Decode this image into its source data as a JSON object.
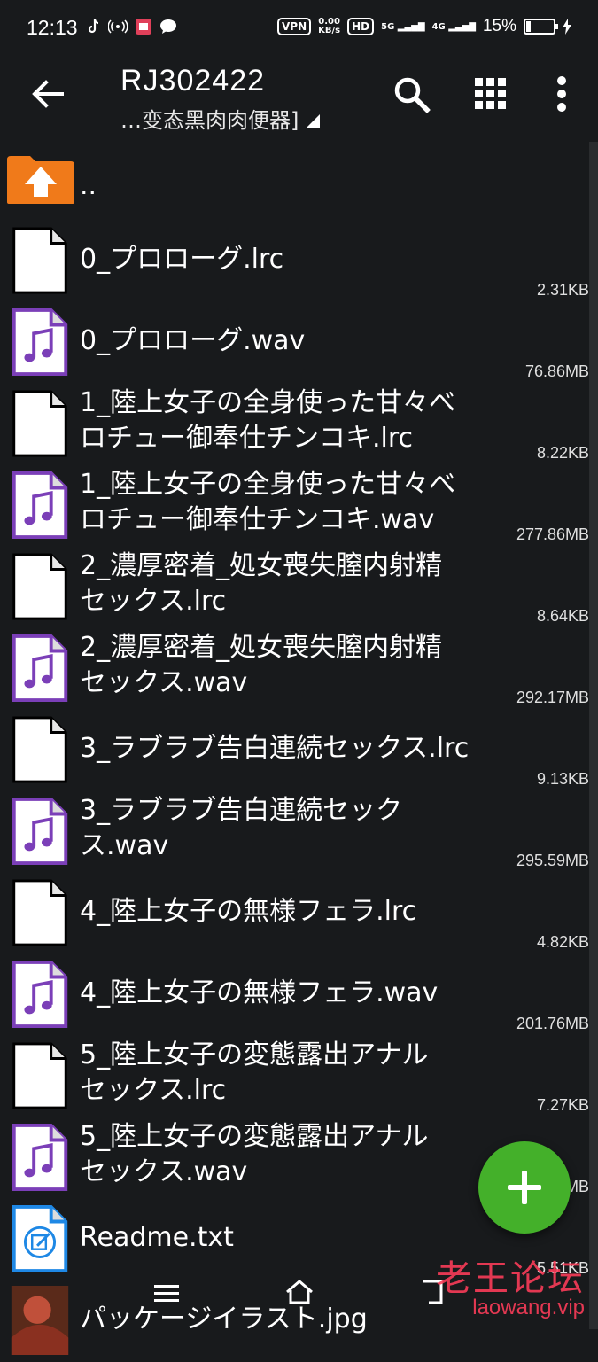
{
  "status_bar": {
    "time": "12:13",
    "vpn": "VPN",
    "net_speed_top": "0.00",
    "net_speed_unit": "KB/s",
    "hd": "HD",
    "sig1": "5G",
    "sig2": "4G",
    "battery": "15%"
  },
  "toolbar": {
    "title": "RJ302422",
    "subtitle": "…变态黑肉肉便器]"
  },
  "parent_dir": "..",
  "files": [
    {
      "name_lines": [
        "0_プロローグ.lrc"
      ],
      "size": "2.31KB",
      "type": "text"
    },
    {
      "name_lines": [
        "0_プロローグ.wav"
      ],
      "size": "76.86MB",
      "type": "audio"
    },
    {
      "name_lines": [
        "1_陸上女子の全身使った甘々べ",
        "ロチュー御奉仕チンコキ.lrc"
      ],
      "size": "8.22KB",
      "type": "text"
    },
    {
      "name_lines": [
        "1_陸上女子の全身使った甘々べ",
        "ロチュー御奉仕チンコキ.wav"
      ],
      "size": "277.86MB",
      "type": "audio"
    },
    {
      "name_lines": [
        "2_濃厚密着_処女喪失膣内射精",
        "セックス.lrc"
      ],
      "size": "8.64KB",
      "type": "text"
    },
    {
      "name_lines": [
        "2_濃厚密着_処女喪失膣内射精",
        "セックス.wav"
      ],
      "size": "292.17MB",
      "type": "audio"
    },
    {
      "name_lines": [
        "3_ラブラブ告白連続セックス.lrc"
      ],
      "size": "9.13KB",
      "type": "text"
    },
    {
      "name_lines": [
        "3_ラブラブ告白連続セック",
        "ス.wav"
      ],
      "size": "295.59MB",
      "type": "audio"
    },
    {
      "name_lines": [
        "4_陸上女子の無様フェラ.lrc"
      ],
      "size": "4.82KB",
      "type": "text"
    },
    {
      "name_lines": [
        "4_陸上女子の無様フェラ.wav"
      ],
      "size": "201.76MB",
      "type": "audio"
    },
    {
      "name_lines": [
        "5_陸上女子の変態露出アナル",
        "セックス.lrc"
      ],
      "size": "7.27KB",
      "type": "text"
    },
    {
      "name_lines": [
        "5_陸上女子の変態露出アナル",
        "セックス.wav"
      ],
      "size": "MB",
      "type": "audio"
    },
    {
      "name_lines": [
        "Readme.txt"
      ],
      "size": "5.51KB",
      "type": "doc"
    },
    {
      "name_lines": [
        "パッケージイラスト.jpg"
      ],
      "size": "",
      "type": "image"
    }
  ],
  "watermark": {
    "cn": "老王论坛",
    "en": "laowang.vip"
  },
  "colors": {
    "background": "#181a1c",
    "audio_icon": "#7b3fb8",
    "folder": "#f07a1a",
    "fab": "#44b02a",
    "doc_icon": "#1e88e5",
    "watermark": "#ff3d5a"
  }
}
